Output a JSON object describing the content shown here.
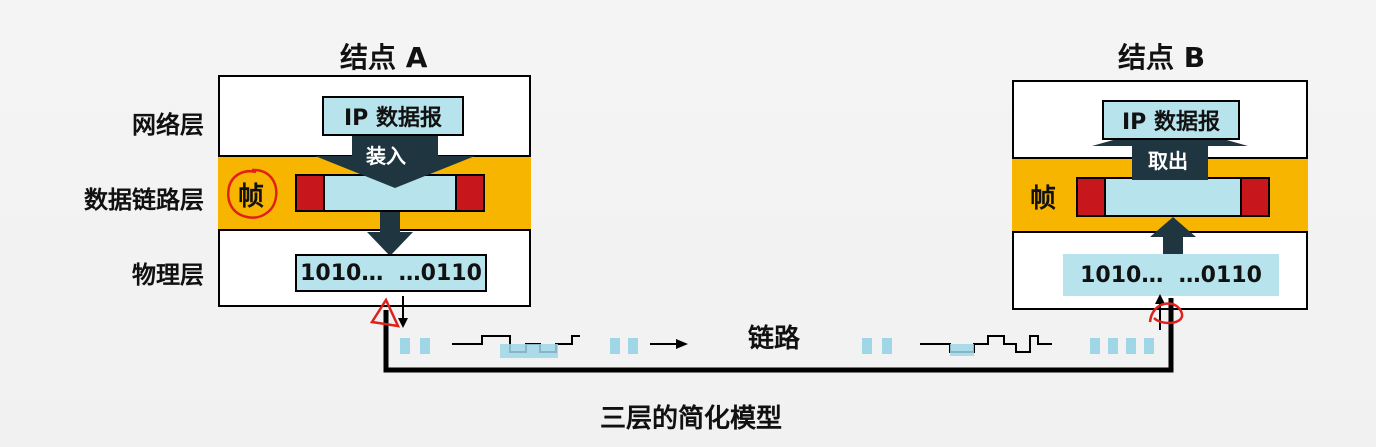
{
  "node_a": {
    "title": "结点 A",
    "ip_label": "IP 数据报",
    "arrow_label": "装入",
    "frame_label": "帧",
    "bits": "1010…  …0110"
  },
  "node_b": {
    "title": "结点 B",
    "ip_label": "IP 数据报",
    "arrow_label": "取出",
    "frame_label": "帧",
    "bits": "1010…  …0110"
  },
  "layers": {
    "network": "网络层",
    "datalink": "数据链路层",
    "physical": "物理层"
  },
  "link_label": "链路",
  "caption": "三层的简化模型",
  "colors": {
    "band": "#f7b500",
    "cyan": "#b7e3ec",
    "arrow": "#1f3540",
    "red": "#c8161d",
    "annotation": "#e0201a"
  }
}
